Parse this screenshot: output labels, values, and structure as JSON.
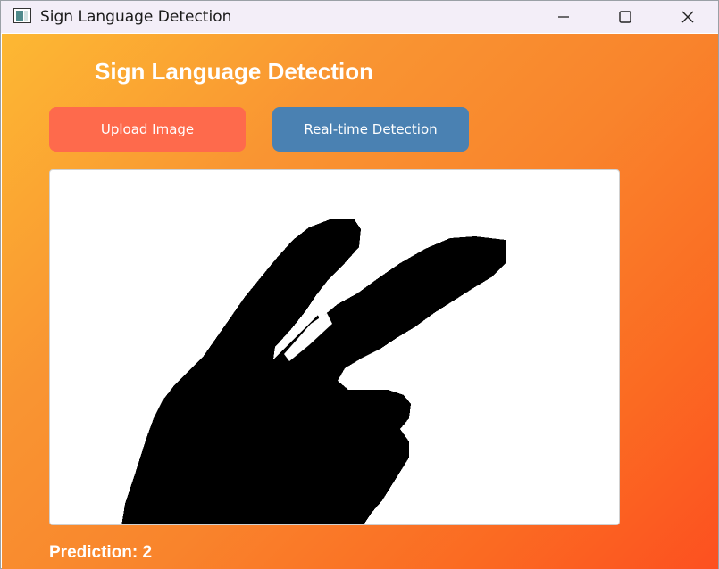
{
  "window": {
    "title": "Sign Language Detection",
    "controls": {
      "minimize": "minimize-icon",
      "maximize": "maximize-icon",
      "close": "close-icon"
    }
  },
  "app": {
    "heading": "Sign Language Detection",
    "buttons": {
      "upload_label": "Upload Image",
      "realtime_label": "Real-time Detection"
    },
    "prediction_text": "Prediction: 2"
  },
  "colors": {
    "gradient_start": "#fdb833",
    "gradient_end": "#fd5020",
    "upload_button": "#fe6a4c",
    "realtime_button": "#4a81b2"
  }
}
